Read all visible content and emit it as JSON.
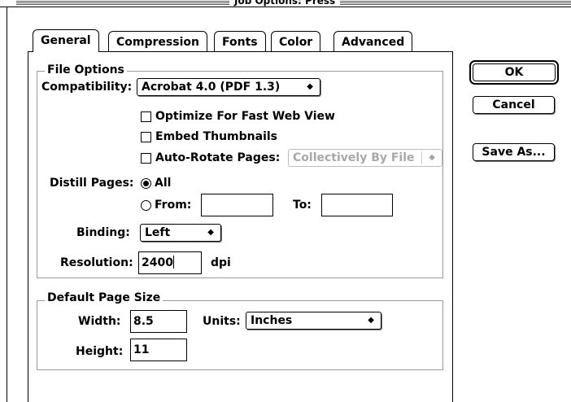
{
  "window": {
    "title": "Job Options: Press"
  },
  "tabs": [
    {
      "label": "General",
      "active": true
    },
    {
      "label": "Compression",
      "active": false
    },
    {
      "label": "Fonts",
      "active": false
    },
    {
      "label": "Color",
      "active": false
    },
    {
      "label": "Advanced",
      "active": false
    }
  ],
  "file_options": {
    "title": "File Options",
    "compatibility_label": "Compatibility:",
    "compatibility_value": "Acrobat 4.0 (PDF 1.3)",
    "optimize_label": "Optimize For Fast Web View",
    "optimize_checked": false,
    "thumbnails_label": "Embed Thumbnails",
    "thumbnails_checked": false,
    "autorotate_label": "Auto-Rotate Pages:",
    "autorotate_checked": false,
    "autorotate_value": "Collectively By File",
    "distill_label": "Distill Pages:",
    "all_label": "All",
    "all_selected": true,
    "from_label": "From:",
    "from_value": "",
    "to_label": "To:",
    "to_value": "",
    "binding_label": "Binding:",
    "binding_value": "Left",
    "resolution_label": "Resolution:",
    "resolution_value": "2400",
    "resolution_unit": "dpi"
  },
  "page_size": {
    "title": "Default Page Size",
    "width_label": "Width:",
    "width_value": "8.5",
    "units_label": "Units:",
    "units_value": "Inches",
    "height_label": "Height:",
    "height_value": "11"
  },
  "buttons": {
    "ok": "OK",
    "cancel": "Cancel",
    "save_as": "Save As..."
  },
  "icons": {
    "popup_arrow": "up-down-arrows-icon",
    "checkbox": "checkbox-icon",
    "radio": "radio-icon"
  }
}
